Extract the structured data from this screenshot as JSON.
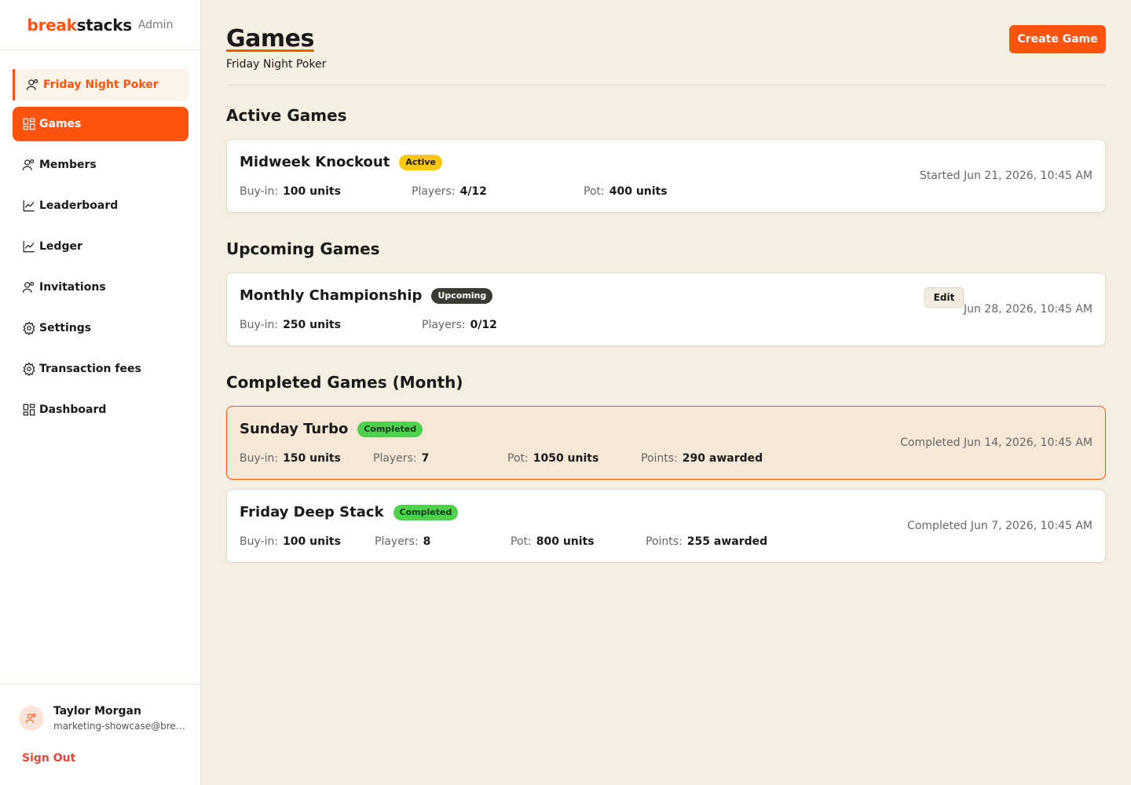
{
  "brand": {
    "part1": "break",
    "part2": "stacks",
    "suffix": "Admin"
  },
  "sidebar": {
    "org": {
      "label": "Friday Night Poker",
      "icon": "users-icon"
    },
    "items": [
      {
        "label": "Games",
        "icon": "grid-icon",
        "active": true
      },
      {
        "label": "Members",
        "icon": "users-icon"
      },
      {
        "label": "Leaderboard",
        "icon": "chart-icon"
      },
      {
        "label": "Ledger",
        "icon": "chart-icon"
      },
      {
        "label": "Invitations",
        "icon": "users-icon"
      },
      {
        "label": "Settings",
        "icon": "gear-icon"
      },
      {
        "label": "Transaction fees",
        "icon": "gear-icon"
      },
      {
        "label": "Dashboard",
        "icon": "grid-icon"
      }
    ]
  },
  "user": {
    "name": "Taylor Morgan",
    "email": "marketing-showcase@breakstacks.com",
    "sign_out": "Sign Out"
  },
  "header": {
    "title": "Games",
    "subtitle": "Friday Night Poker",
    "create_label": "Create Game"
  },
  "labels": {
    "buy_in": "Buy-in:",
    "players": "Players:",
    "pot": "Pot:",
    "points": "Points:"
  },
  "sections": {
    "active": {
      "title": "Active Games",
      "games": [
        {
          "name": "Midweek Knockout",
          "status": "Active",
          "buy_in": "100 units",
          "players": "4/12",
          "pot": "400 units",
          "date": "Started Jun 21, 2026, 10:45 AM"
        }
      ]
    },
    "upcoming": {
      "title": "Upcoming Games",
      "games": [
        {
          "name": "Monthly Championship",
          "status": "Upcoming",
          "buy_in": "250 units",
          "players": "0/12",
          "date": "Jun 28, 2026, 10:45 AM",
          "edit_label": "Edit"
        }
      ]
    },
    "completed": {
      "title": "Completed Games (Month)",
      "games": [
        {
          "name": "Sunday Turbo",
          "status": "Completed",
          "buy_in": "150 units",
          "players": "7",
          "pot": "1050 units",
          "points": "290 awarded",
          "date": "Completed Jun 14, 2026, 10:45 AM"
        },
        {
          "name": "Friday Deep Stack",
          "status": "Completed",
          "buy_in": "100 units",
          "players": "8",
          "pot": "800 units",
          "points": "255 awarded",
          "date": "Completed Jun 7, 2026, 10:45 AM"
        }
      ]
    }
  },
  "colors": {
    "accent": "#ff5310",
    "background": "#f4efe1",
    "active_badge": "#fcc80f",
    "upcoming_badge": "#3b3a33",
    "completed_badge": "#4ed24e"
  }
}
